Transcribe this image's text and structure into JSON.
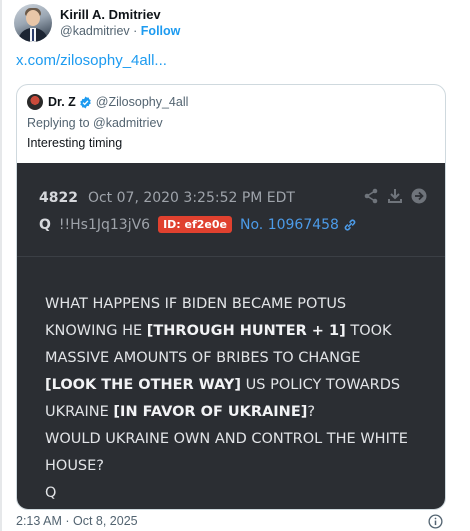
{
  "author": {
    "display_name": "Kirill A. Dmitriev",
    "handle": "@kadmitriev",
    "separator": "·",
    "follow_label": "Follow"
  },
  "link_text": "x.com/zilosophy_4all...",
  "quote": {
    "name": "Dr. Z",
    "handle": "@Zilosophy_4all",
    "replying_to": "Replying to @kadmitriev",
    "text": "Interesting timing"
  },
  "post": {
    "number": "4822",
    "date": "Oct 07, 2020 3:25:52 PM EDT",
    "q": "Q",
    "tripcode": "!!Hs1Jq13jV6",
    "id_badge": "ID: ef2e0e",
    "post_no": "No. 10967458",
    "lines": [
      {
        "plain": "WHAT HAPPENS IF BIDEN BECAME POTUS",
        "bold": "",
        "after": ""
      },
      {
        "plain": "KNOWING HE ",
        "bold": "[THROUGH HUNTER + 1]",
        "after": " TOOK"
      },
      {
        "plain": "MASSIVE AMOUNTS OF BRIBES TO CHANGE",
        "bold": "",
        "after": ""
      },
      {
        "plain": "",
        "bold": "[LOOK THE OTHER WAY]",
        "after": " US POLICY TOWARDS"
      },
      {
        "plain": "UKRAINE ",
        "bold": "[IN FAVOR OF UKRAINE]",
        "after": "?"
      },
      {
        "plain": "WOULD UKRAINE OWN AND CONTROL THE WHITE",
        "bold": "",
        "after": ""
      },
      {
        "plain": "HOUSE?",
        "bold": "",
        "after": ""
      },
      {
        "plain": "Q",
        "bold": "",
        "after": ""
      }
    ]
  },
  "timestamp": "2:13 AM · Oct 8, 2025",
  "icons": {
    "share": "share-icon",
    "download": "download-icon",
    "forward": "arrow-right-icon",
    "link": "link-icon",
    "verified": "verified-badge-icon",
    "info": "info-icon"
  },
  "colors": {
    "accent": "#1d9bf0",
    "post_bg": "#2b2e33",
    "id_badge": "#e0412f",
    "post_no": "#4c9be8"
  }
}
